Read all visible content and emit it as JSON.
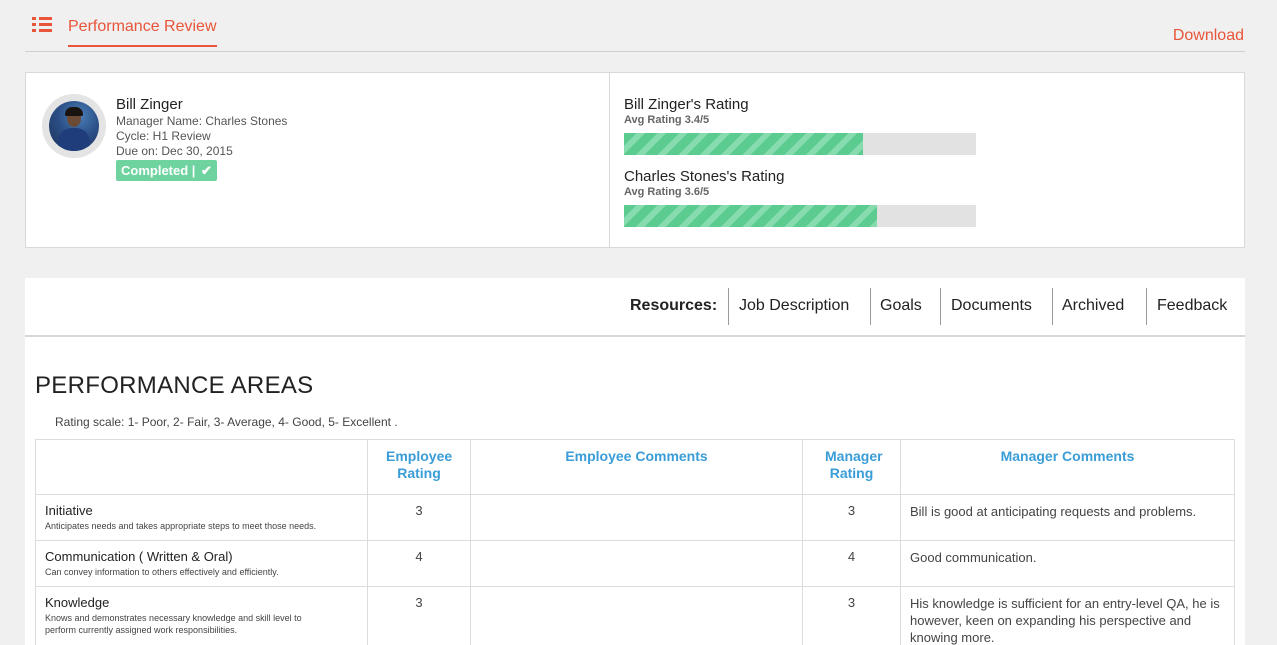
{
  "header": {
    "menu_icon": "list-icon",
    "tab_label": "Performance Review",
    "download_label": "Download"
  },
  "employee": {
    "name": "Bill Zinger",
    "manager": "Manager Name: Charles Stones",
    "cycle": "Cycle: H1 Review",
    "due": "Due on: Dec 30, 2015",
    "status": "Completed |",
    "status_icon": "check-icon"
  },
  "ratings": [
    {
      "title": "Bill Zinger's Rating",
      "avg": "Avg Rating 3.4/5",
      "value": 3.4,
      "max": 5
    },
    {
      "title": "Charles Stones's Rating",
      "avg": "Avg Rating 3.6/5",
      "value": 3.6,
      "max": 5
    }
  ],
  "resources": {
    "label": "Resources:",
    "items": [
      "Job Description",
      "Goals",
      "Documents",
      "Archived",
      "Feedback"
    ]
  },
  "performance": {
    "title": "PERFORMANCE AREAS",
    "scale": "Rating scale: 1- Poor, 2- Fair, 3- Average, 4- Good, 5- Excellent .",
    "columns": [
      "",
      "Employee Rating",
      "Employee Comments",
      "Manager Rating",
      "Manager Comments"
    ],
    "rows": [
      {
        "name": "Initiative",
        "desc": "Anticipates needs and takes appropriate steps to meet those needs.",
        "emp_rating": "3",
        "emp_comment": "",
        "mgr_rating": "3",
        "mgr_comment": "Bill is good at anticipating requests and problems."
      },
      {
        "name": "Communication ( Written & Oral)",
        "desc": "Can convey information to others effectively and efficiently.",
        "emp_rating": "4",
        "emp_comment": "",
        "mgr_rating": "4",
        "mgr_comment": "Good communication."
      },
      {
        "name": "Knowledge",
        "desc": "Knows and demonstrates necessary knowledge and skill level to perform currently assigned work responsibilities.",
        "emp_rating": "3",
        "emp_comment": "",
        "mgr_rating": "3",
        "mgr_comment": "His knowledge is sufficient for an entry-level QA, he is however, keen on expanding his perspective and knowing more."
      }
    ]
  },
  "colors": {
    "accent": "#e8553a",
    "header_blue": "#3a9dd8",
    "completed_green": "#6fd3a0",
    "bar_fill": "#5ccb90",
    "bar_track": "#e2e2e2"
  }
}
